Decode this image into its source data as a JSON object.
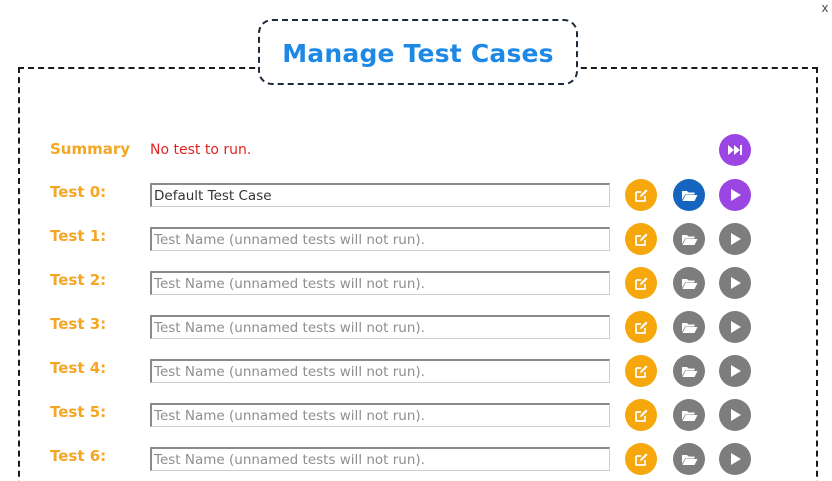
{
  "dialog": {
    "title": "Manage Test Cases",
    "close_label": "x"
  },
  "summary": {
    "label": "Summary",
    "message": "No test to run.",
    "run_all_icon": "fast-forward-icon"
  },
  "tests": [
    {
      "label": "Test 0:",
      "value": "Default Test Case",
      "placeholder": "Test Name (unnamed tests will not run).",
      "enabled": true
    },
    {
      "label": "Test 1:",
      "value": "",
      "placeholder": "Test Name (unnamed tests will not run).",
      "enabled": false
    },
    {
      "label": "Test 2:",
      "value": "",
      "placeholder": "Test Name (unnamed tests will not run).",
      "enabled": false
    },
    {
      "label": "Test 3:",
      "value": "",
      "placeholder": "Test Name (unnamed tests will not run).",
      "enabled": false
    },
    {
      "label": "Test 4:",
      "value": "",
      "placeholder": "Test Name (unnamed tests will not run).",
      "enabled": false
    },
    {
      "label": "Test 5:",
      "value": "",
      "placeholder": "Test Name (unnamed tests will not run).",
      "enabled": false
    },
    {
      "label": "Test 6:",
      "value": "",
      "placeholder": "Test Name (unnamed tests will not run).",
      "enabled": false
    }
  ],
  "icons": {
    "edit": "edit-icon",
    "open": "folder-open-icon",
    "run": "play-icon"
  },
  "colors": {
    "title": "#1e88e5",
    "label": "#f5a623",
    "summary_message": "#e02424",
    "edit_button": "#f5a70b",
    "open_active": "#1565c0",
    "run_active": "#9b46e2",
    "disabled_button": "#7d7d7d"
  }
}
